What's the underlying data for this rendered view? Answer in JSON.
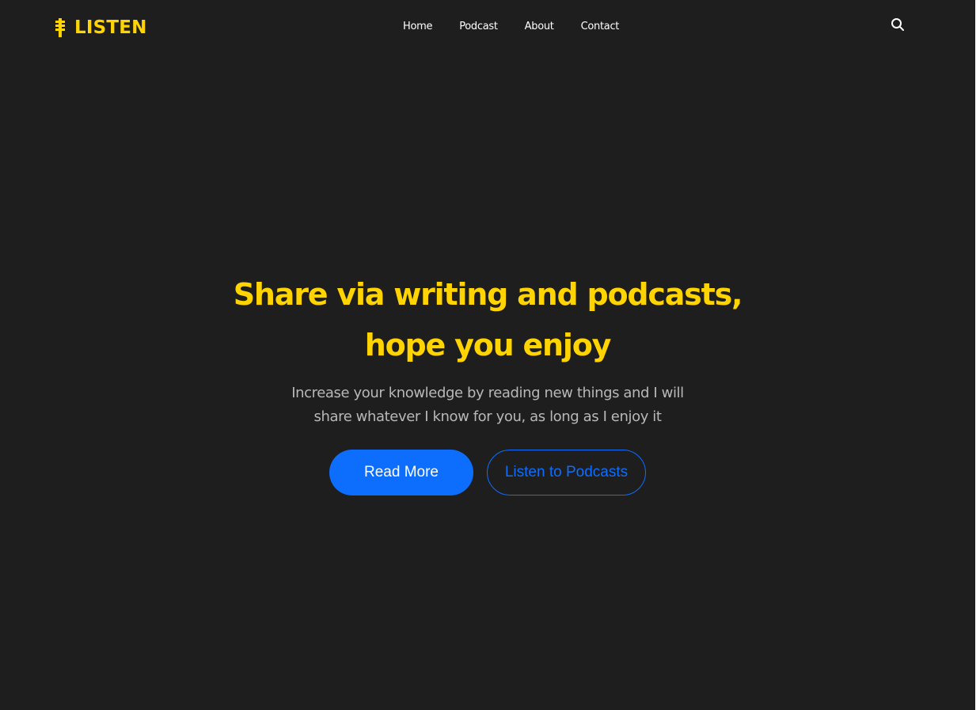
{
  "brand": {
    "name": "LISTEN",
    "icon": "microphone-icon",
    "color": "#ffd400"
  },
  "nav": {
    "items": [
      {
        "label": "Home"
      },
      {
        "label": "Podcast"
      },
      {
        "label": "About"
      },
      {
        "label": "Contact"
      }
    ],
    "search_icon": "search-icon"
  },
  "hero": {
    "title_line1": "Share via writing and podcasts,",
    "title_line2": "hope you enjoy",
    "subtitle_line1": "Increase your knowledge by reading new things and I will",
    "subtitle_line2": "share whatever I know for you, as long as I enjoy it",
    "primary_button": "Read More",
    "secondary_button": "Listen to Podcasts"
  },
  "colors": {
    "background": "#1e1e1e",
    "accent": "#ffd400",
    "primary": "#0d6efd",
    "text": "#ffffff",
    "muted": "#b8b8b8"
  }
}
